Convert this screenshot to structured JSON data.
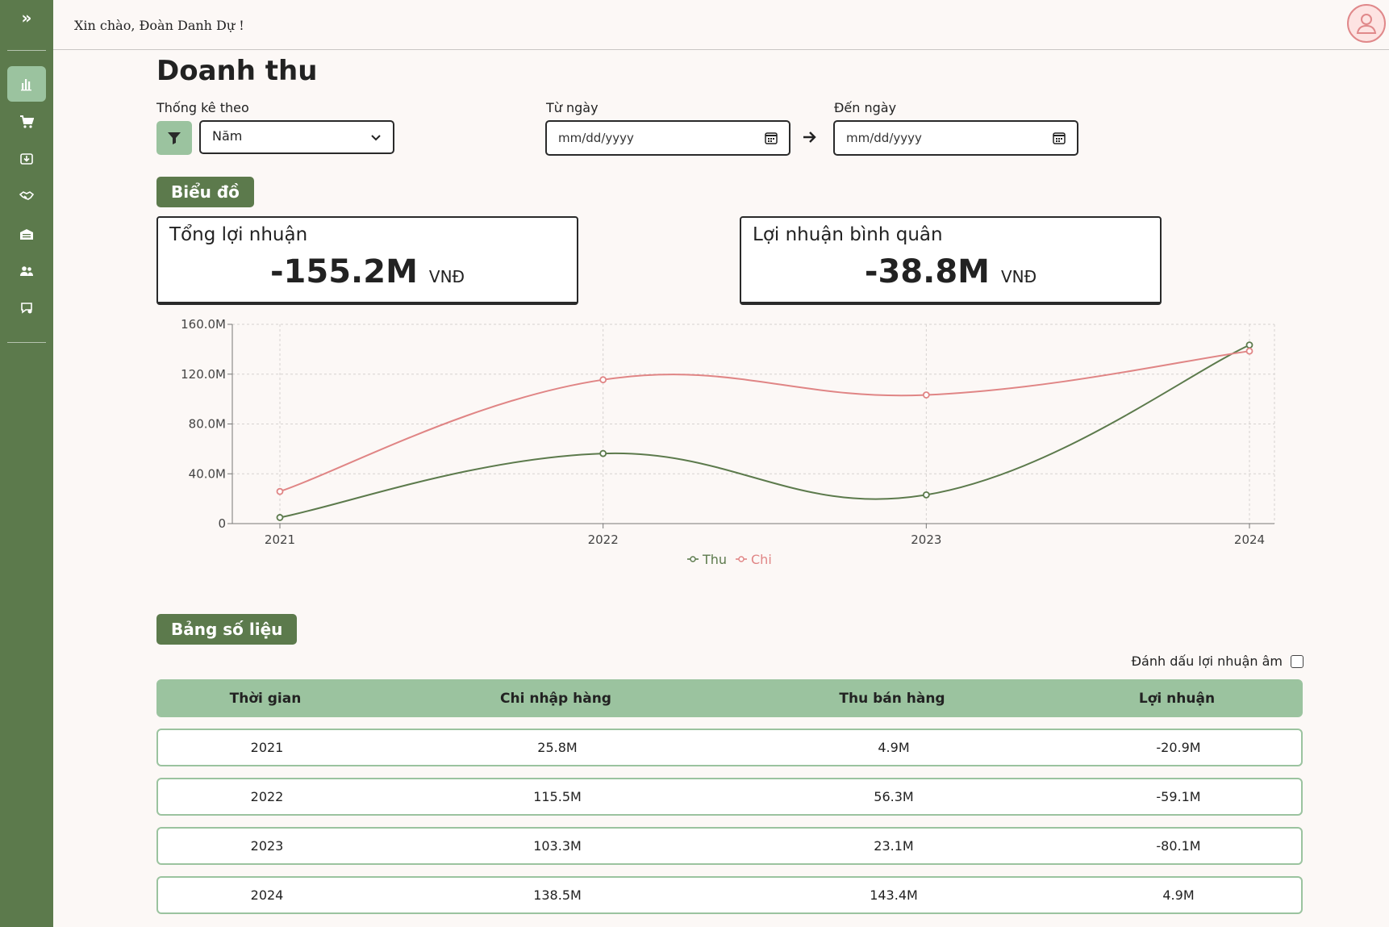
{
  "topbar": {
    "greeting": "Xin chào, Đoàn Danh Dự !"
  },
  "page": {
    "title": "Doanh thu"
  },
  "filters": {
    "group_label": "Thống kê theo",
    "group_value": "Năm",
    "from_label": "Từ ngày",
    "from_placeholder": "mm/dd/yyyy",
    "to_label": "Đến ngày",
    "to_placeholder": "mm/dd/yyyy"
  },
  "sections": {
    "chart": "Biểu đồ",
    "table": "Bảng số liệu"
  },
  "stats": {
    "total_title": "Tổng lợi nhuận",
    "total_value": "-155.2M",
    "total_unit": "VNĐ",
    "avg_title": "Lợi nhuận bình quân",
    "avg_value": "-38.8M",
    "avg_unit": "VNĐ"
  },
  "chart_data": {
    "type": "line",
    "x": [
      "2021",
      "2022",
      "2023",
      "2024"
    ],
    "series": [
      {
        "name": "Thu",
        "values": [
          4.9,
          56.3,
          23.1,
          143.4
        ],
        "color": "#5c7a4c"
      },
      {
        "name": "Chi",
        "values": [
          25.8,
          115.5,
          103.3,
          138.5
        ],
        "color": "#e08585"
      }
    ],
    "ylim": [
      0,
      160
    ],
    "yticks": [
      "0",
      "40.0M",
      "80.0M",
      "120.0M",
      "160.0M"
    ],
    "grid": true,
    "legend": "bottom-center"
  },
  "table": {
    "negative_toggle_label": "Đánh dấu lợi nhuận âm",
    "headers": [
      "Thời gian",
      "Chi nhập hàng",
      "Thu bán hàng",
      "Lợi nhuận"
    ],
    "rows": [
      [
        "2021",
        "25.8M",
        "4.9M",
        "-20.9M"
      ],
      [
        "2022",
        "115.5M",
        "56.3M",
        "-59.1M"
      ],
      [
        "2023",
        "103.3M",
        "23.1M",
        "-80.1M"
      ],
      [
        "2024",
        "138.5M",
        "143.4M",
        "4.9M"
      ]
    ]
  },
  "colors": {
    "sidebar": "#5c7a4c",
    "accent_light": "#9bc39f",
    "expense": "#e08585",
    "income": "#5c7a4c"
  },
  "icons": {
    "sidebar": [
      "bar-chart-icon",
      "cart-icon",
      "import-icon",
      "handshake-icon",
      "warehouse-icon",
      "users-icon",
      "settings-chat-icon"
    ]
  }
}
